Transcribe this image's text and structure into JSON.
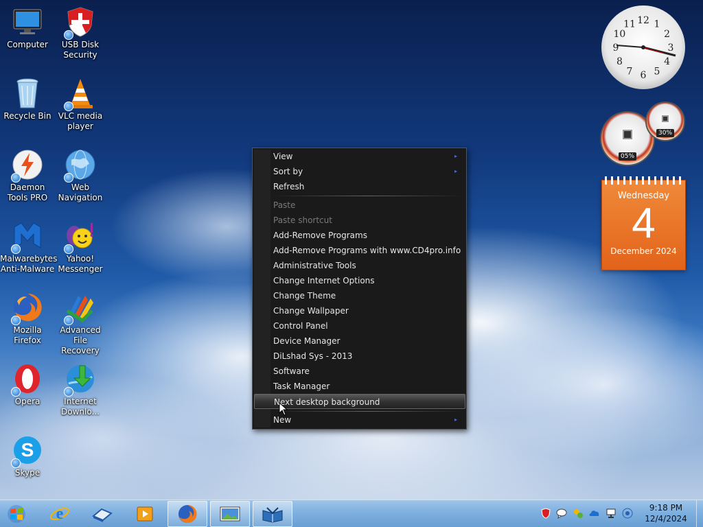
{
  "desktop_icons": [
    {
      "name": "computer",
      "label": "Computer"
    },
    {
      "name": "usb-disk-security",
      "label": "USB Disk\nSecurity"
    },
    {
      "name": "recycle-bin",
      "label": "Recycle Bin"
    },
    {
      "name": "vlc",
      "label": "VLC media\nplayer"
    },
    {
      "name": "daemon-tools",
      "label": "Daemon\nTools PRO"
    },
    {
      "name": "web-navigation",
      "label": "Web\nNavigation"
    },
    {
      "name": "malwarebytes",
      "label": "Malwarebytes\nAnti-Malware"
    },
    {
      "name": "yahoo-messenger",
      "label": "Yahoo!\nMessenger"
    },
    {
      "name": "firefox",
      "label": "Mozilla\nFirefox"
    },
    {
      "name": "advanced-file-recovery",
      "label": "Advanced File\nRecovery"
    },
    {
      "name": "opera",
      "label": "Opera"
    },
    {
      "name": "internet-download",
      "label": "Internet\nDownlo..."
    },
    {
      "name": "skype",
      "label": "Skype"
    }
  ],
  "gadgets": {
    "clock": {
      "numbers": [
        "12",
        "1",
        "2",
        "3",
        "4",
        "5",
        "6",
        "7",
        "8",
        "9",
        "10",
        "11"
      ]
    },
    "meter": {
      "cpu": "05%",
      "memory": "30%"
    },
    "calendar": {
      "weekday": "Wednesday",
      "day": "4",
      "month_year": "December 2024"
    }
  },
  "context_menu": {
    "items": [
      {
        "label": "View",
        "submenu": true
      },
      {
        "label": "Sort by",
        "submenu": true
      },
      {
        "label": "Refresh"
      },
      {
        "label": "Paste",
        "disabled": true
      },
      {
        "label": "Paste shortcut",
        "disabled": true
      },
      {
        "label": "Add-Remove Programs"
      },
      {
        "label": "Add-Remove Programs with www.CD4pro.info"
      },
      {
        "label": "Administrative Tools"
      },
      {
        "label": "Change Internet Options"
      },
      {
        "label": "Change Theme"
      },
      {
        "label": "Change Wallpaper"
      },
      {
        "label": "Control Panel"
      },
      {
        "label": "Device Manager"
      },
      {
        "label": "DiLshad Sys - 2013"
      },
      {
        "label": "Software"
      },
      {
        "label": "Task Manager"
      },
      {
        "label": "Next desktop background",
        "highlighted": true
      },
      {
        "label": "New",
        "submenu": true
      }
    ],
    "submenu_arrow": "▸"
  },
  "taskbar": {
    "pinned": [
      "internet-explorer",
      "windows-explorer",
      "media-player",
      "firefox",
      "desktop-background",
      "reader"
    ],
    "tray_icons": [
      "usb-security-tray",
      "messenger-tray",
      "settings-tray",
      "onedrive-tray",
      "network-tray",
      "volume-tray"
    ],
    "time": "9:18 PM",
    "date": "12/4/2024"
  },
  "colors": {
    "menu_bg": "#1a1a1a",
    "calendar": "#e8702a",
    "taskbar": "#7eb0e0"
  }
}
